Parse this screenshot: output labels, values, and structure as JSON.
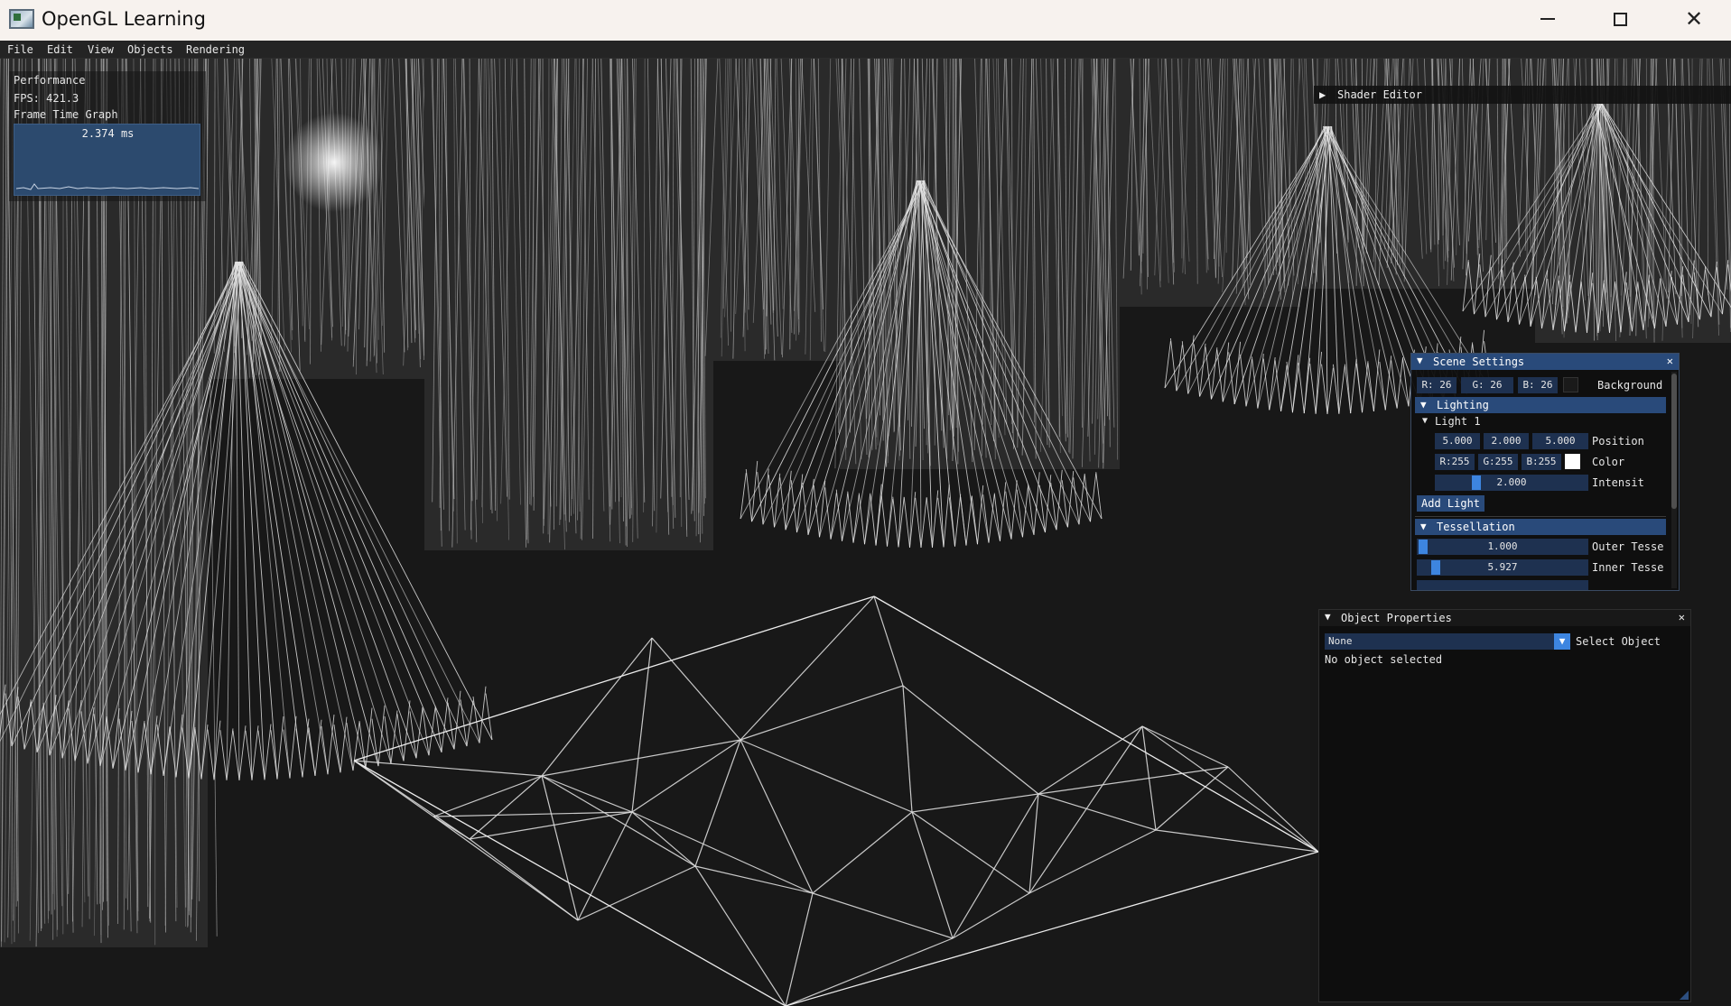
{
  "window": {
    "title": "OpenGL Learning",
    "minimize_glyph": "minimize-icon",
    "maximize_glyph": "maximize-icon",
    "close_glyph": "✕"
  },
  "menu": [
    "File",
    "Edit",
    "View",
    "Objects",
    "Rendering"
  ],
  "performance": {
    "title": "Performance",
    "fps": "FPS: 421.3",
    "graph_label": "Frame Time Graph",
    "frame_time": "2.374 ms"
  },
  "shader_editor": {
    "arrow": "▶",
    "title": "Shader Editor"
  },
  "scene_settings": {
    "title": "Scene Settings",
    "arrow": "▼",
    "close": "✕",
    "background": {
      "r": "R: 26",
      "g": "G: 26",
      "b": "B: 26",
      "label": "Background",
      "color": "#1a1a1a"
    },
    "lighting": {
      "title": "Lighting",
      "light1": {
        "title": "Light 1",
        "position": [
          "5.000",
          "2.000",
          "5.000"
        ],
        "position_label": "Position",
        "color": {
          "r": "R:255",
          "g": "G:255",
          "b": "B:255",
          "label": "Color",
          "swatch": "#ffffff"
        },
        "intensity": "2.000",
        "intensity_label": "Intensit",
        "intensity_fraction": 0.25
      },
      "add_light": "Add Light"
    },
    "tessellation": {
      "title": "Tessellation",
      "outer": "1.000",
      "outer_label": "Outer Tesse",
      "outer_fraction": 0.0,
      "inner": "5.927",
      "inner_label": "Inner Tesse",
      "inner_fraction": 0.08
    }
  },
  "object_properties": {
    "title": "Object Properties",
    "arrow": "▼",
    "close": "✕",
    "selected": "None",
    "select_label": "Select Object",
    "status": "No object selected"
  },
  "colors": {
    "accent": "#3d85e0",
    "header": "#294a7a",
    "frame_bg": "#1e3150",
    "viewport_bg": "#181818"
  }
}
